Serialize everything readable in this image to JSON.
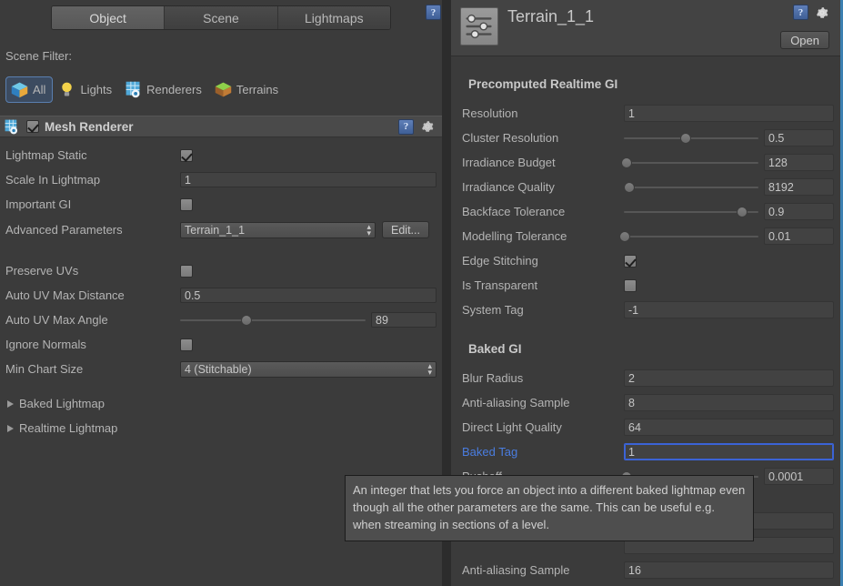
{
  "tabs": [
    {
      "label": "Object",
      "active": true
    },
    {
      "label": "Scene",
      "active": false
    },
    {
      "label": "Lightmaps",
      "active": false
    }
  ],
  "left": {
    "scene_filter_label": "Scene Filter:",
    "filters": [
      {
        "label": "All",
        "icon": "cube-icon",
        "selected": true
      },
      {
        "label": "Lights",
        "icon": "lightbulb-icon",
        "selected": false
      },
      {
        "label": "Renderers",
        "icon": "renderer-icon",
        "selected": false
      },
      {
        "label": "Terrains",
        "icon": "terrain-icon",
        "selected": false
      }
    ],
    "component": {
      "title": "Mesh Renderer",
      "enabled": true
    },
    "props": [
      {
        "label": "Lightmap Static",
        "type": "checkbox",
        "value": true
      },
      {
        "label": "Scale In Lightmap",
        "type": "text",
        "value": "1"
      },
      {
        "label": "Important GI",
        "type": "checkbox",
        "value": false
      },
      {
        "label": "Advanced Parameters",
        "type": "popup",
        "value": "Terrain_1_1",
        "button": "Edit..."
      },
      {
        "label": "Preserve UVs",
        "type": "checkbox",
        "value": false
      },
      {
        "label": "Auto UV Max Distance",
        "type": "text",
        "value": "0.5"
      },
      {
        "label": "Auto UV Max Angle",
        "type": "slider",
        "value": "89",
        "pct": 36
      },
      {
        "label": "Ignore Normals",
        "type": "checkbox",
        "value": false
      },
      {
        "label": "Min Chart Size",
        "type": "popup",
        "value": "4 (Stitchable)"
      }
    ],
    "foldouts": [
      {
        "label": "Baked Lightmap"
      },
      {
        "label": "Realtime Lightmap"
      }
    ]
  },
  "right": {
    "asset_name": "Terrain_1_1",
    "open_label": "Open",
    "sections": [
      {
        "title": "Precomputed Realtime GI",
        "rows": [
          {
            "label": "Resolution",
            "type": "text",
            "value": "1"
          },
          {
            "label": "Cluster Resolution",
            "type": "slider",
            "value": "0.5",
            "pct": 46
          },
          {
            "label": "Irradiance Budget",
            "type": "slider",
            "value": "128",
            "pct": 2
          },
          {
            "label": "Irradiance Quality",
            "type": "slider",
            "value": "8192",
            "pct": 4
          },
          {
            "label": "Backface Tolerance",
            "type": "slider",
            "value": "0.9",
            "pct": 88
          },
          {
            "label": "Modelling Tolerance",
            "type": "slider",
            "value": "0.01",
            "pct": 1
          },
          {
            "label": "Edge Stitching",
            "type": "checkbox",
            "value": true
          },
          {
            "label": "Is Transparent",
            "type": "checkbox",
            "value": false
          },
          {
            "label": "System Tag",
            "type": "text",
            "value": "-1"
          }
        ]
      },
      {
        "title": "Baked GI",
        "rows": [
          {
            "label": "Blur Radius",
            "type": "text",
            "value": "2"
          },
          {
            "label": "Anti-aliasing Sample",
            "type": "text",
            "value": "8"
          },
          {
            "label": "Direct Light Quality",
            "type": "text",
            "value": "64"
          },
          {
            "label": "Baked Tag",
            "type": "text",
            "value": "1",
            "focused": true,
            "highlight": true
          },
          {
            "label": "Pushoff",
            "type": "slider",
            "value": "0.0001",
            "pct": 2
          },
          {
            "label": "Anti-aliasing Sample",
            "type": "text",
            "value": "16"
          }
        ]
      }
    ]
  },
  "tooltip": {
    "text": "An integer that lets you force an object into a different baked lightmap even though all the other parameters are the same. This can be useful e.g. when streaming in sections of a level."
  },
  "colors": {
    "accent_blue": "#3b7fb0",
    "focus_blue": "#3b63d6",
    "highlight_label": "#4a7de0",
    "panel_bg": "#3b3b3b"
  }
}
